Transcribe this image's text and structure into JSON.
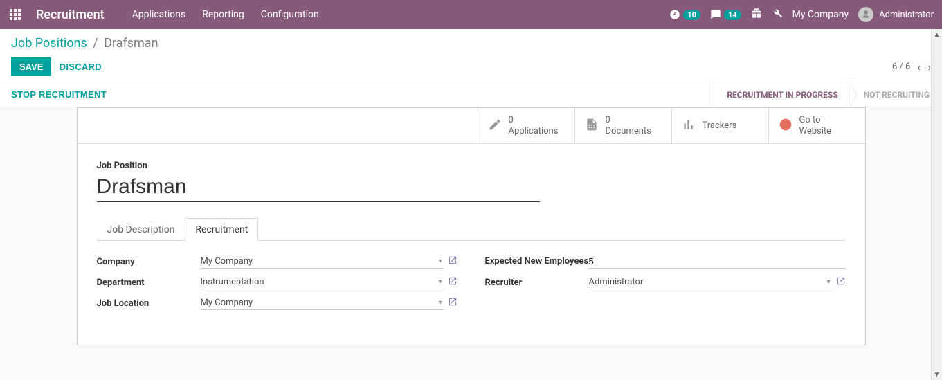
{
  "header": {
    "brand": "Recruitment",
    "menu": [
      "Applications",
      "Reporting",
      "Configuration"
    ],
    "activity_count": "10",
    "message_count": "14",
    "company": "My Company",
    "user": "Administrator"
  },
  "breadcrumb": {
    "root": "Job Positions",
    "current": "Drafsman"
  },
  "buttons": {
    "save": "SAVE",
    "discard": "DISCARD",
    "stop": "STOP RECRUITMENT"
  },
  "pager": {
    "text": "6 / 6"
  },
  "status": {
    "active": "RECRUITMENT IN PROGRESS",
    "inactive": "NOT RECRUITING"
  },
  "stat_buttons": {
    "applications": {
      "count": "0",
      "label": "Applications"
    },
    "documents": {
      "count": "0",
      "label": "Documents"
    },
    "trackers": {
      "label": "Trackers"
    },
    "website": {
      "label1": "Go to",
      "label2": "Website"
    }
  },
  "form": {
    "title_label": "Job Position",
    "title_value": "Drafsman",
    "tabs": {
      "desc": "Job Description",
      "recruit": "Recruitment"
    },
    "labels": {
      "company": "Company",
      "department": "Department",
      "location": "Job Location",
      "expected": "Expected New Employees",
      "recruiter": "Recruiter"
    },
    "values": {
      "company": "My Company",
      "department": "Instrumentation",
      "location": "My Company",
      "expected": "5",
      "recruiter": "Administrator"
    }
  }
}
